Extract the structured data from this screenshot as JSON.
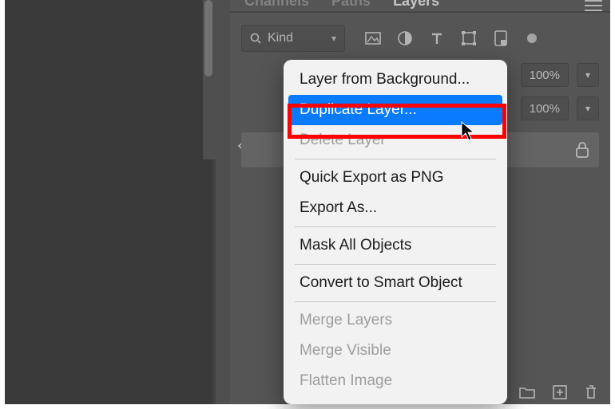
{
  "tabs": {
    "channels": "Channels",
    "paths": "Paths",
    "layers": "Layers"
  },
  "filter": {
    "kind_label": "Kind"
  },
  "opacity": {
    "value": "100%"
  },
  "fill": {
    "value": "100%"
  },
  "context_menu": {
    "layer_from_bg": "Layer from Background...",
    "duplicate": "Duplicate Layer...",
    "delete": "Delete Layer",
    "quick_export": "Quick Export as PNG",
    "export_as": "Export As...",
    "mask_all": "Mask All Objects",
    "convert_smart": "Convert to Smart Object",
    "merge_layers": "Merge Layers",
    "merge_visible": "Merge Visible",
    "flatten": "Flatten Image"
  }
}
